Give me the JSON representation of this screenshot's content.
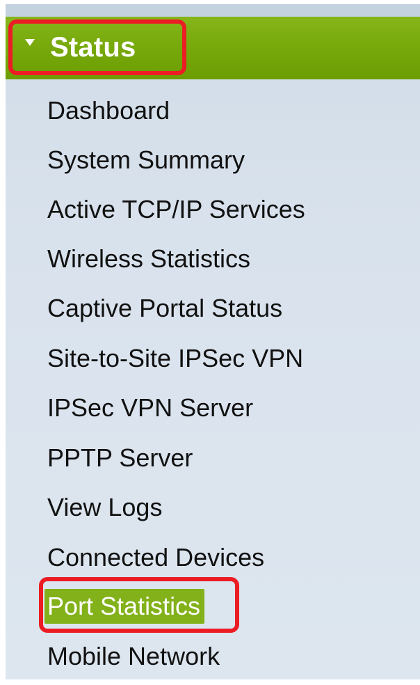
{
  "status_section": {
    "label": "Status",
    "expanded": true
  },
  "menu": {
    "items": [
      {
        "label": "Dashboard",
        "active": false
      },
      {
        "label": "System Summary",
        "active": false
      },
      {
        "label": "Active TCP/IP Services",
        "active": false
      },
      {
        "label": "Wireless Statistics",
        "active": false
      },
      {
        "label": "Captive Portal Status",
        "active": false
      },
      {
        "label": "Site-to-Site IPSec VPN",
        "active": false
      },
      {
        "label": "IPSec VPN Server",
        "active": false
      },
      {
        "label": "PPTP Server",
        "active": false
      },
      {
        "label": "View Logs",
        "active": false
      },
      {
        "label": "Connected Devices",
        "active": false
      },
      {
        "label": "Port Statistics",
        "active": true
      },
      {
        "label": "Mobile Network",
        "active": false
      }
    ]
  },
  "colors": {
    "status_bar_green": "#78aa0c",
    "active_item_green": "#82b11a",
    "highlight_red": "#ec1c24",
    "panel_blue": "#d6e0eb"
  }
}
